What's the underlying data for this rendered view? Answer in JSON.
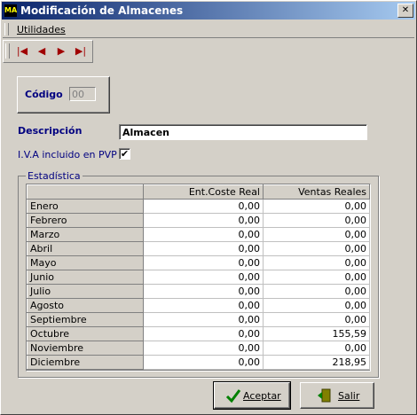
{
  "window": {
    "title": "Modificación de Almacenes",
    "close_symbol": "✕"
  },
  "menu": {
    "utilidades": "Utilidades"
  },
  "nav": {
    "first": "|◀",
    "prev": "◀",
    "next": "▶",
    "last": "▶|",
    "accent_color": "#a00000"
  },
  "form": {
    "codigo_label": "Código",
    "codigo_value": "00",
    "descripcion_label": "Descripción",
    "descripcion_value": "Almacen",
    "iva_label": "I.V.A incluido en PVP",
    "iva_checked": "✔"
  },
  "estadistica": {
    "legend": "Estadística",
    "columns": [
      "",
      "Ent.Coste Real",
      "Ventas Reales"
    ],
    "rows": [
      {
        "month": "Enero",
        "coste": "0,00",
        "ventas": "0,00"
      },
      {
        "month": "Febrero",
        "coste": "0,00",
        "ventas": "0,00"
      },
      {
        "month": "Marzo",
        "coste": "0,00",
        "ventas": "0,00"
      },
      {
        "month": "Abril",
        "coste": "0,00",
        "ventas": "0,00"
      },
      {
        "month": "Mayo",
        "coste": "0,00",
        "ventas": "0,00"
      },
      {
        "month": "Junio",
        "coste": "0,00",
        "ventas": "0,00"
      },
      {
        "month": "Julio",
        "coste": "0,00",
        "ventas": "0,00"
      },
      {
        "month": "Agosto",
        "coste": "0,00",
        "ventas": "0,00"
      },
      {
        "month": "Septiembre",
        "coste": "0,00",
        "ventas": "0,00"
      },
      {
        "month": "Octubre",
        "coste": "0,00",
        "ventas": "155,59"
      },
      {
        "month": "Noviembre",
        "coste": "0,00",
        "ventas": "0,00"
      },
      {
        "month": "Diciembre",
        "coste": "0,00",
        "ventas": "218,95"
      }
    ]
  },
  "buttons": {
    "accept": "Aceptar",
    "exit": "Salir"
  },
  "icons": {
    "accept": "checkmark-icon",
    "exit": "exit-door-icon"
  },
  "colors": {
    "title_start": "#0a246a",
    "title_end": "#a6caf0",
    "label_blue": "#000080",
    "check_green": "#008000"
  }
}
